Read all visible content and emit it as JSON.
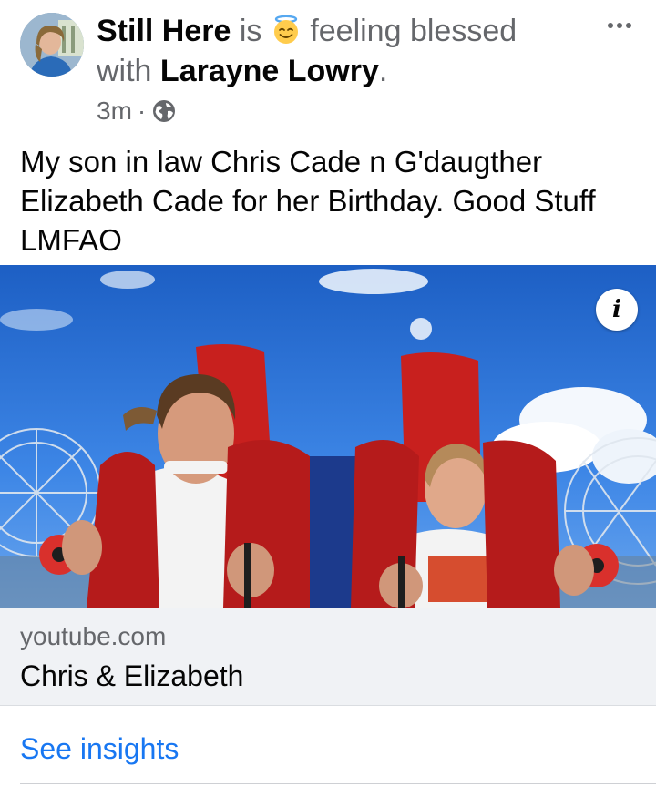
{
  "post": {
    "author": "Still Here",
    "is_word": "is",
    "feeling": "feeling blessed",
    "with_word": "with",
    "tagged": "Larayne Lowry",
    "period": ".",
    "time": "3m",
    "separator": "·",
    "privacy_icon": "globe-icon",
    "feeling_icon": "smiling-face-with-halo-icon",
    "message": "My son in law Chris Cade n G'daugther Elizabeth Cade for her Birthday. Good Stuff LMFAO"
  },
  "media": {
    "info_label": "i"
  },
  "link": {
    "domain": "youtube.com",
    "title": "Chris & Elizabeth"
  },
  "insights": {
    "label": "See insights"
  },
  "colors": {
    "primary_text": "#050505",
    "secondary_text": "#65676b",
    "link_blue": "#1877f2",
    "preview_bg": "#f0f2f5"
  }
}
